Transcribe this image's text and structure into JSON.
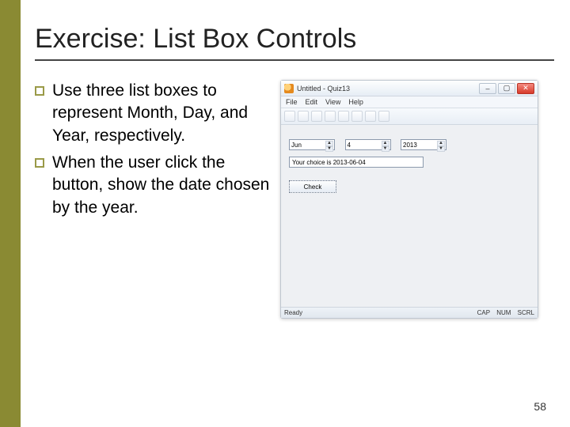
{
  "slide": {
    "title": "Exercise: List Box Controls",
    "page_number": "58",
    "bullets": [
      "Use three list boxes to represent Month, Day, and Year, respectively.",
      "When the user click the button, show the date chosen by the year."
    ]
  },
  "app": {
    "window_title": "Untitled - Quiz13",
    "menus": [
      "File",
      "Edit",
      "View",
      "Help"
    ],
    "listboxes": {
      "month": "Jun",
      "day": "4",
      "year": "2013"
    },
    "output_text": "Your choice is 2013-06-04",
    "button_label": "Check",
    "status_left": "Ready",
    "status_right": [
      "CAP",
      "NUM",
      "SCRL"
    ]
  }
}
